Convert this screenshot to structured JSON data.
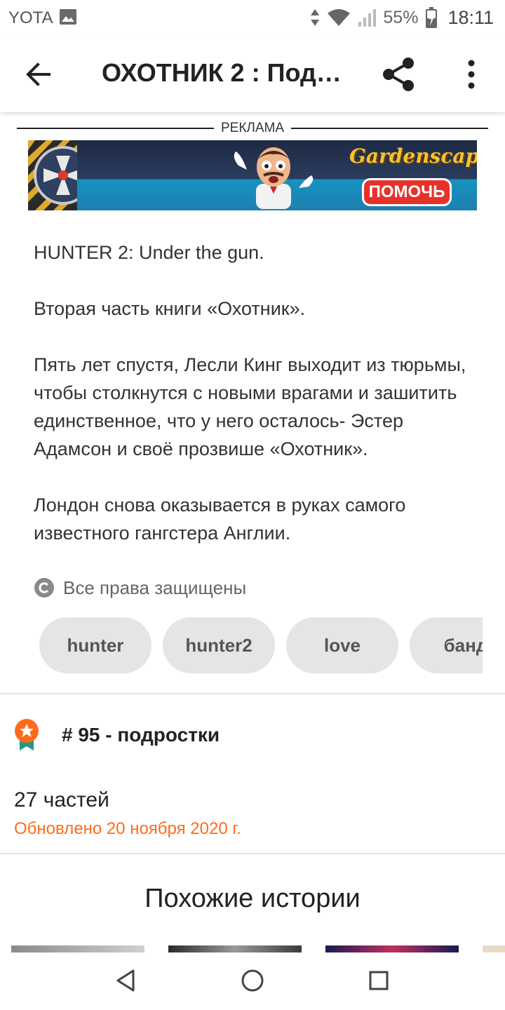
{
  "status_bar": {
    "carrier": "YOTA",
    "battery": "55%",
    "time": "18:11"
  },
  "app_bar": {
    "title": "ОХОТНИК 2 : Под…"
  },
  "ad": {
    "label": "РЕКЛАМА",
    "logo_text": "Gardenscapes",
    "cta_label": "ПОМОЧЬ"
  },
  "description": {
    "paragraphs": [
      "HUNTER 2: Under the gun.",
      "Вторая часть книги «Охотник».",
      "Пять лет спустя, Лесли Кинг выходит из тюрьмы, чтобы столкнутся с новыми врагами и зашитить единственное, что у него осталось- Эстер Адамсон и своё прозвише «Охотник».",
      "Лондон снова оказывается в руках самого известного гангстера Англии."
    ]
  },
  "rights": {
    "text": "Все права защищены"
  },
  "tags": [
    "hunter",
    "hunter2",
    "love",
    "банд"
  ],
  "ranking": {
    "text": "# 95 - подростки"
  },
  "story_info": {
    "parts": "27 частей",
    "updated": "Обновлено 20 ноября 2020 г."
  },
  "similar": {
    "title": "Похожие истории"
  },
  "colors": {
    "accent": "#ff6b1b",
    "tag_bg": "#e6e5e6"
  }
}
